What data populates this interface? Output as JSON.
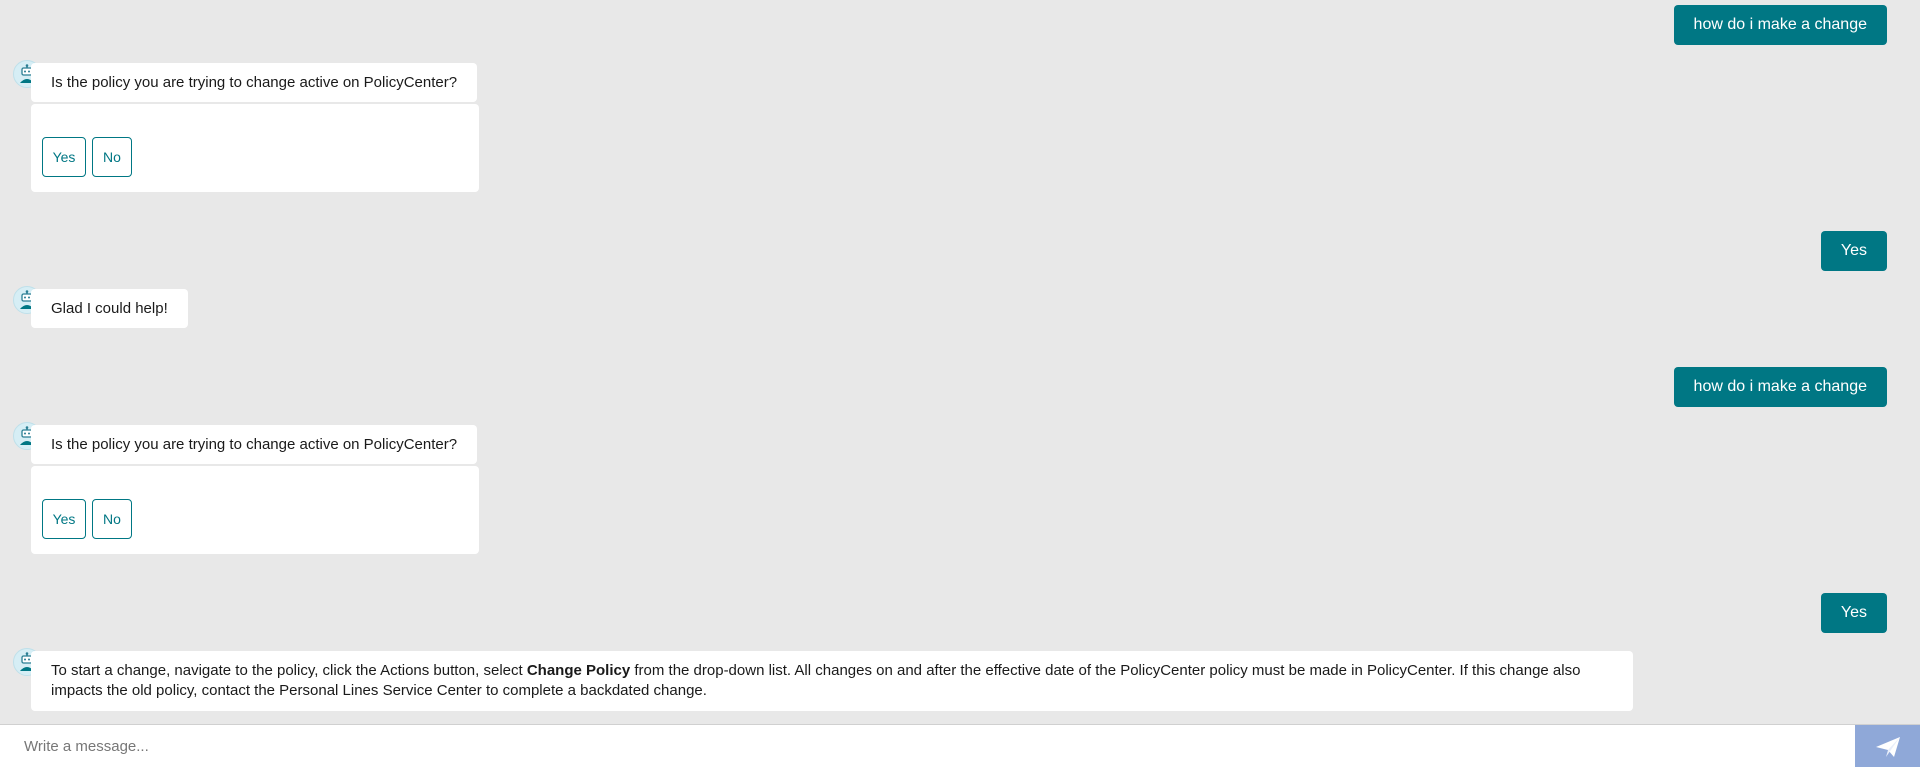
{
  "messages": {
    "m1_user": "how do i make a change",
    "m2_bot": "Is the policy you are trying to change active on PolicyCenter?",
    "m2_options": [
      "Yes",
      "No"
    ],
    "m3_user": "Yes",
    "m4_bot": "Glad I could help!",
    "m5_user": "how do i make a change",
    "m6_bot": "Is the policy you are trying to change active on PolicyCenter?",
    "m6_options": [
      "Yes",
      "No"
    ],
    "m7_user": "Yes",
    "m8_bot": {
      "before": "To start a change, navigate to the policy, click the Actions button, select ",
      "bold": "Change Policy",
      "after": " from the drop-down list. All changes on and after the effective date of the PolicyCenter policy must be made in PolicyCenter. If this change also impacts the old policy, contact the Personal Lines Service Center to complete a backdated change."
    }
  },
  "composer": {
    "placeholder": "Write a message..."
  },
  "icons": {
    "bot_avatar": "robot-icon",
    "send": "paper-plane-icon"
  },
  "colors": {
    "accent": "#007784",
    "background": "#e8e8e8",
    "send_button": "#8fa8d8"
  }
}
